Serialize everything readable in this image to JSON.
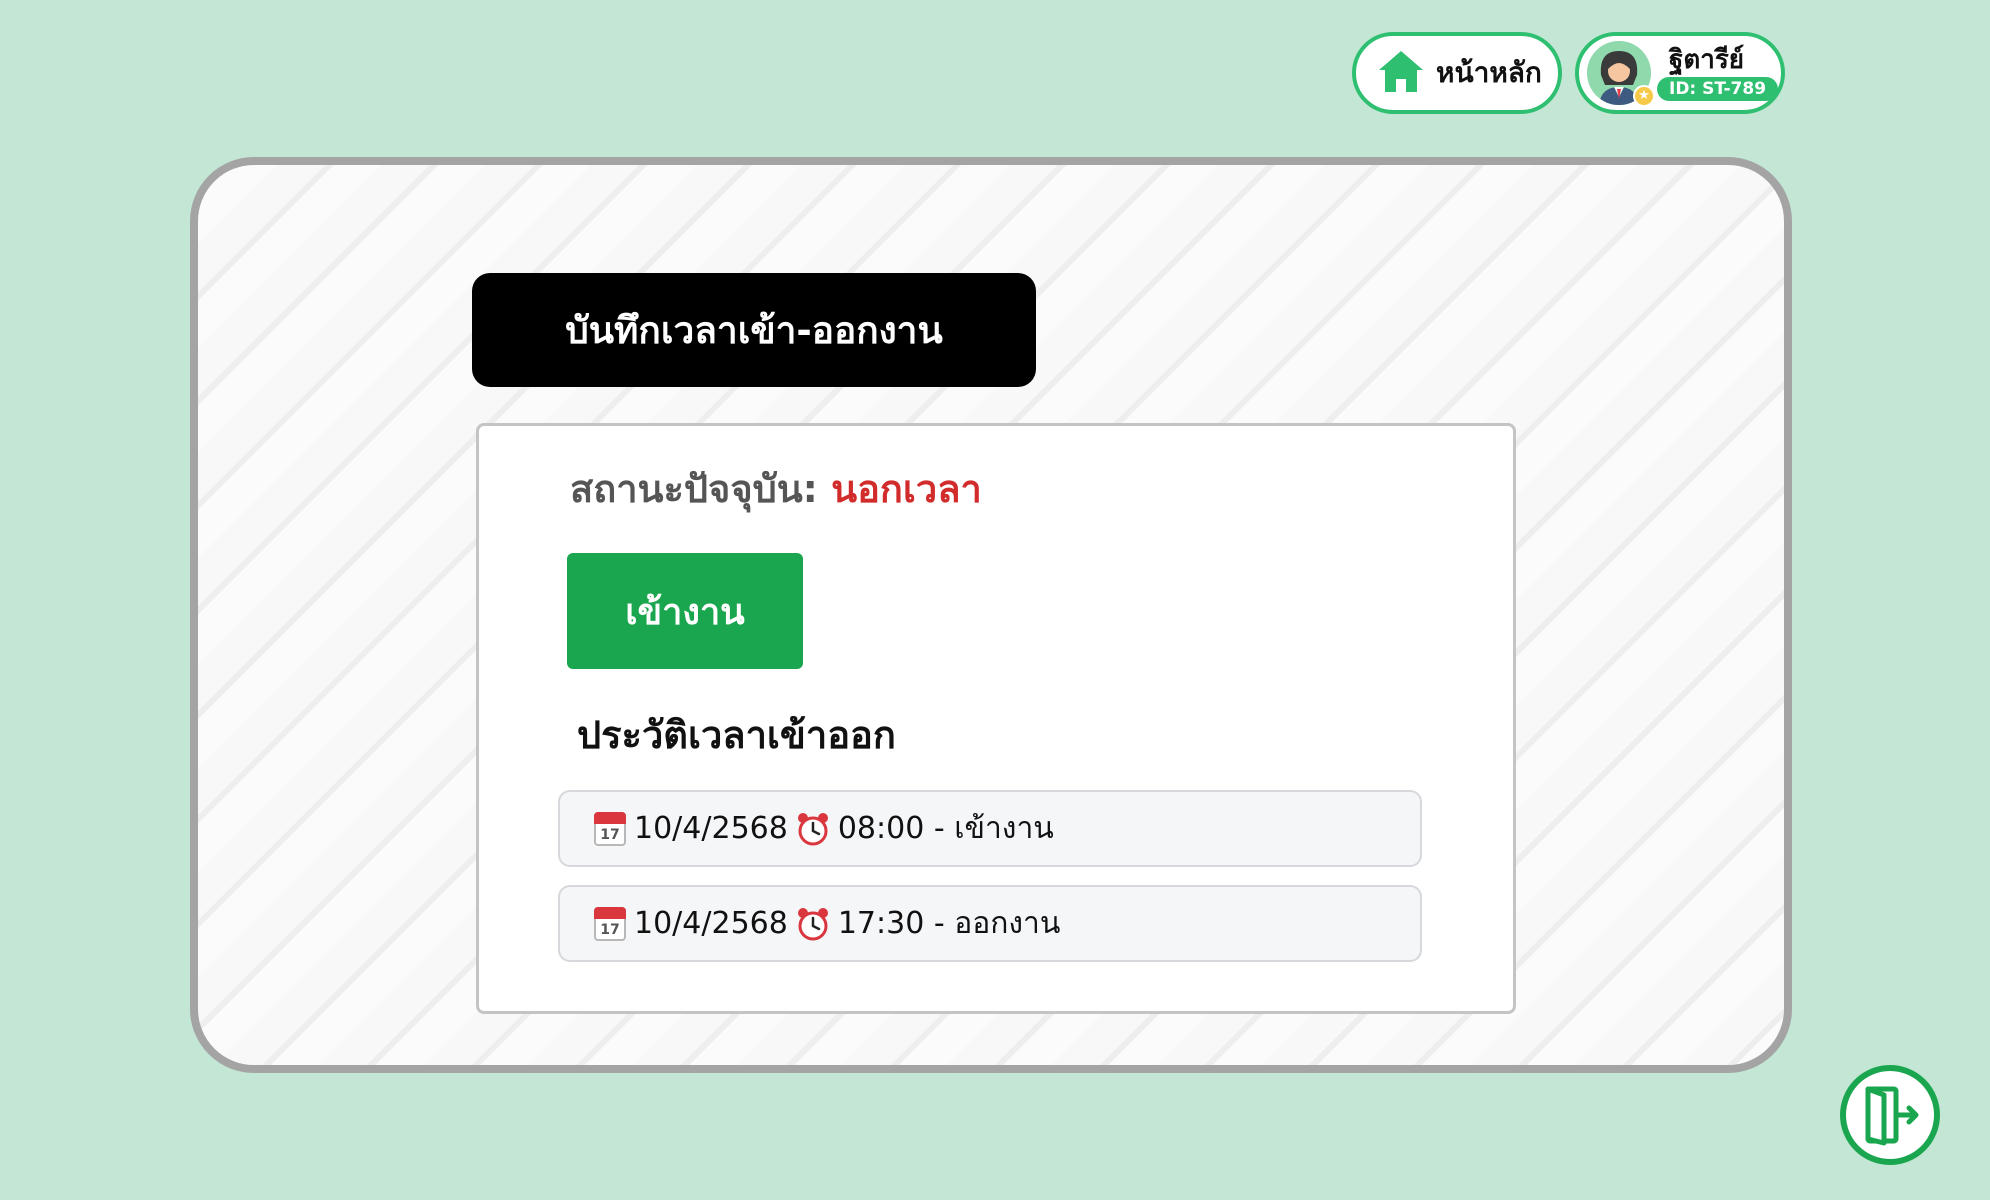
{
  "header": {
    "home_label": "หน้าหลัก",
    "user_name": "ฐิตารีย์",
    "user_id": "ID: ST-789"
  },
  "card": {
    "title": "บันทึกเวลาเข้า-ออกงาน",
    "status_label": "สถานะปัจจุบัน:",
    "status_value": "นอกเวลา",
    "checkin_label": "เข้างาน",
    "history_title": "ประวัติเวลาเข้าออก",
    "history": [
      {
        "date": "10/4/2568",
        "time": "08:00",
        "action": "เข้างาน"
      },
      {
        "date": "10/4/2568",
        "time": "17:30",
        "action": "ออกงาน"
      }
    ]
  },
  "colors": {
    "background": "#c3e7d4",
    "accent_green": "#2fbf71",
    "button_green": "#1aa64e",
    "status_red": "#d22b2b"
  },
  "icons": {
    "home": "home-icon",
    "avatar": "user-avatar",
    "calendar": "calendar-icon",
    "clock": "alarm-clock-icon",
    "logout": "logout-door-icon"
  }
}
